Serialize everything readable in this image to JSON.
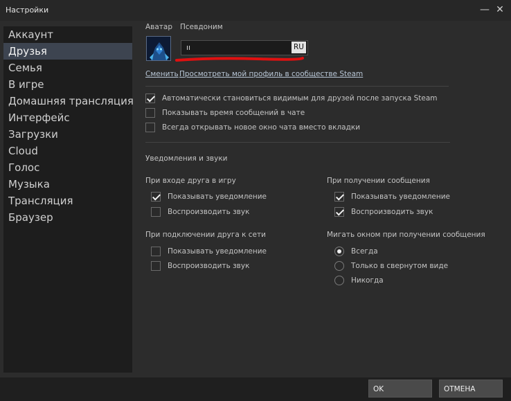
{
  "window": {
    "title": "Настройки",
    "minimize_glyph": "—",
    "close_glyph": "✕"
  },
  "sidebar": {
    "items": [
      {
        "label": "Аккаунт",
        "active": false
      },
      {
        "label": "Друзья",
        "active": true
      },
      {
        "label": "Семья",
        "active": false
      },
      {
        "label": "В игре",
        "active": false
      },
      {
        "label": "Домашняя трансляция",
        "active": false
      },
      {
        "label": "Интерфейс",
        "active": false
      },
      {
        "label": "Загрузки",
        "active": false
      },
      {
        "label": "Cloud",
        "active": false
      },
      {
        "label": "Голос",
        "active": false
      },
      {
        "label": "Музыка",
        "active": false
      },
      {
        "label": "Трансляция",
        "active": false
      },
      {
        "label": "Браузер",
        "active": false
      }
    ]
  },
  "profile": {
    "avatar_label": "Аватар",
    "nickname_label": "Псевдоним",
    "nickname_value": "ıı",
    "lang_badge": "RU",
    "change_link": "Сменить",
    "view_profile_link": "Просмотреть мой профиль в сообществе Steam"
  },
  "options": [
    {
      "label": "Автоматически становиться видимым для друзей после запуска Steam",
      "checked": true
    },
    {
      "label": "Показывать время сообщений в чате",
      "checked": false
    },
    {
      "label": "Всегда открывать новое окно чата вместо вкладки",
      "checked": false
    }
  ],
  "notifications": {
    "title": "Уведомления и звуки",
    "friend_ingame": {
      "title": "При входе друга в игру",
      "show_label": "Показывать уведомление",
      "show_checked": true,
      "sound_label": "Воспроизводить звук",
      "sound_checked": false
    },
    "message_received": {
      "title": "При получении сообщения",
      "show_label": "Показывать уведомление",
      "show_checked": true,
      "sound_label": "Воспроизводить звук",
      "sound_checked": true
    },
    "friend_online": {
      "title": "При подключении друга к сети",
      "show_label": "Показывать уведомление",
      "show_checked": false,
      "sound_label": "Воспроизводить звук",
      "sound_checked": false
    },
    "flash_window": {
      "title": "Мигать окном при получении сообщения",
      "options": [
        "Всегда",
        "Только в свернутом виде",
        "Никогда"
      ],
      "selected": "Всегда"
    }
  },
  "buttons": {
    "ok": "OK",
    "cancel": "ОТМЕНА"
  },
  "colors": {
    "active_item": "#3d4450",
    "annotation_red": "#e01010"
  }
}
